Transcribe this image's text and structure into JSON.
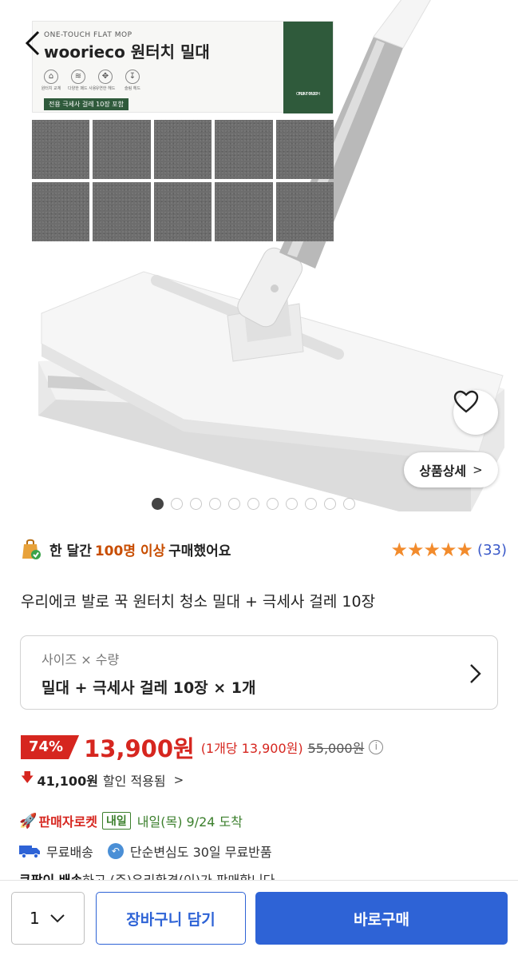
{
  "hero": {
    "brand_sub": "ONE-TOUCH FLAT MOP",
    "brand_main": "woorieco 원터치 밀대",
    "features": [
      "원터치 교체",
      "다양한 패드 사용",
      "유연한 헤드",
      "슬림 헤드"
    ],
    "pill": "전용 극세사 걸레 10장 포함",
    "side_label_1": "ONE-TOUCH",
    "side_label_2": "FLAT MOP",
    "detail_label": "상품상세",
    "slide_count": 11,
    "active_slide": 0
  },
  "popular": {
    "prefix": "한 달간",
    "highlight": "100명 이상",
    "suffix": "구매했어요"
  },
  "rating": {
    "stars": "★★★★★",
    "value": 5,
    "count": "(33)"
  },
  "title": "우리에코 발로 꾹 원터치 청소 밀대 + 극세사 걸레 10장",
  "option": {
    "label": "사이즈 × 수량",
    "value": "밀대 +  극세사 걸레 10장 × 1개"
  },
  "price": {
    "discount": "74%",
    "sale": "13,900원",
    "unit": "(1개당 13,900원)",
    "original": "55,000원"
  },
  "discount_info": {
    "amount": "41,100원",
    "text": "할인 적용됨"
  },
  "delivery": {
    "rocket": "판매자로켓",
    "badge": "내일",
    "arrive": "내일(목) 9/24 도착"
  },
  "shipping": {
    "free": "무료배송",
    "returns": "단순변심도 30일 무료반품"
  },
  "cut_line": {
    "bold": "쿠팡이 배송",
    "rest": "하고 (주)우리환경(이)가 판매합니다"
  },
  "bottom": {
    "qty": "1",
    "cart": "장바구니 담기",
    "buy": "바로구매"
  },
  "colors": {
    "accent_blue": "#2e63d6",
    "price_red": "#d6261f",
    "delivery_green": "#3b7f2c",
    "star_orange": "#f28b2c"
  }
}
